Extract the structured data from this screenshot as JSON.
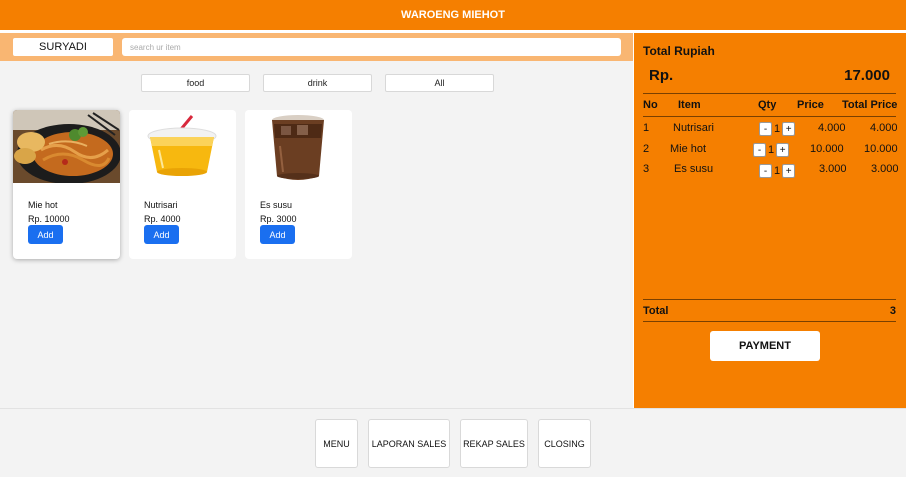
{
  "header": {
    "title": "WAROENG MIEHOT"
  },
  "topbar": {
    "user": "SURYADI",
    "search_placeholder": "search ur item"
  },
  "filters": [
    "food",
    "drink",
    "All"
  ],
  "products": [
    {
      "name": "Mie hot",
      "price": "Rp. 10000",
      "add_label": "Add"
    },
    {
      "name": "Nutrisari",
      "price": "Rp. 4000",
      "add_label": "Add"
    },
    {
      "name": "Es susu",
      "price": "Rp. 3000",
      "add_label": "Add"
    }
  ],
  "cart": {
    "title": "Total Rupiah",
    "currency": "Rp.",
    "amount": "17.000",
    "headers": {
      "no": "No",
      "item": "Item",
      "qty": "Qty",
      "price": "Price",
      "total": "Total Price"
    },
    "rows": [
      {
        "no": "1",
        "item": "Nutrisari",
        "qty": "1",
        "price": "4.000",
        "total": "4.000"
      },
      {
        "no": "2",
        "item": "Mie hot",
        "qty": "1",
        "price": "10.000",
        "total": "10.000"
      },
      {
        "no": "3",
        "item": "Es susu",
        "qty": "1",
        "price": "3.000",
        "total": "3.000"
      }
    ],
    "minus": "-",
    "plus": "+",
    "total_label": "Total",
    "total_count": "3",
    "payment_label": "PAYMENT"
  },
  "nav": [
    "MENU",
    "LAPORAN SALES",
    "REKAP SALES",
    "CLOSING"
  ],
  "colors": {
    "accent": "#f57f00",
    "topbar": "#f9b672",
    "button_blue": "#1a6ff0"
  }
}
